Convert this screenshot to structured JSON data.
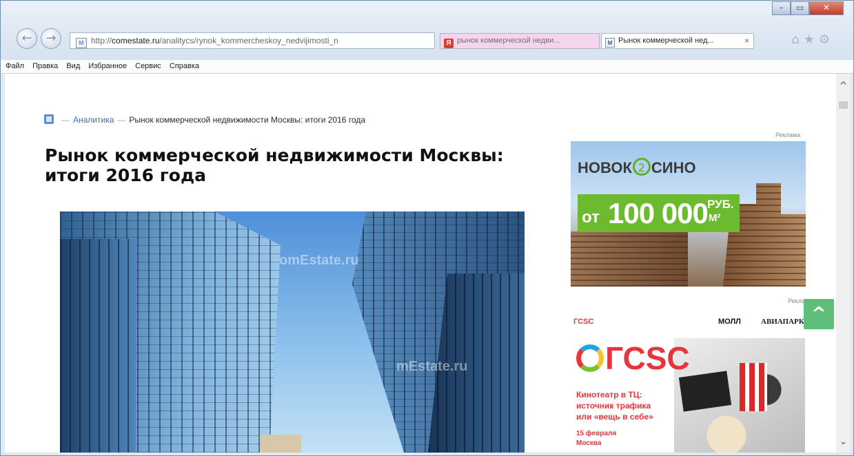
{
  "browser": {
    "url_prefix": "http://",
    "url_domain": "comestate.ru",
    "url_path": "/analitycs/rynok_kommercheskoy_nedvijimosti_n",
    "address_icons": [
      "⌕",
      "▾",
      "⊘",
      "↻"
    ],
    "tabs": [
      {
        "label": "рынок коммерческой недви...",
        "icon_text": "Я"
      },
      {
        "label": "Рынок коммерческой нед...",
        "icon_text": "M",
        "close": "×"
      }
    ],
    "toolbar_icons": [
      "⌂",
      "★",
      "⚙"
    ],
    "window_controls": {
      "minimize": "–",
      "maximize": "▭",
      "close": "✕"
    },
    "nav": {
      "back": "←",
      "forward": "→"
    },
    "addr_favicon": "M"
  },
  "menubar": {
    "items": [
      "Файл",
      "Правка",
      "Вид",
      "Избранное",
      "Сервис",
      "Справка"
    ]
  },
  "page": {
    "breadcrumb": {
      "separator": "—",
      "link": "Аналитика",
      "current": "Рынок коммерческой недвижимости Москвы: итоги 2016 года"
    },
    "title": "Рынок коммерческой недвижимости Москвы: итоги 2016 года",
    "hero_watermarks": [
      "omEstate.ru",
      "mEstate.ru"
    ]
  },
  "sidebar": {
    "ad_label": "Реклама",
    "ad1": {
      "logo_left": "НОВОК",
      "logo_mid": "2",
      "logo_right": "СИНО",
      "prefix": "от",
      "price": "100 000",
      "currency": "РУБ.",
      "unit": "М²"
    },
    "ad2": {
      "partners": [
        "ГСSC",
        "МОЛЛ",
        "АВИАПАРК"
      ],
      "logo": "ГСSC",
      "headline_lines": [
        "Кинотеатр в ТЦ:",
        "источник трафика",
        "или «вещь в себе»"
      ],
      "date": "15 февраля",
      "city": "Москва"
    },
    "scroll_top_icon": "^"
  },
  "scrollbar": {
    "up": "^",
    "down": "⌄"
  }
}
